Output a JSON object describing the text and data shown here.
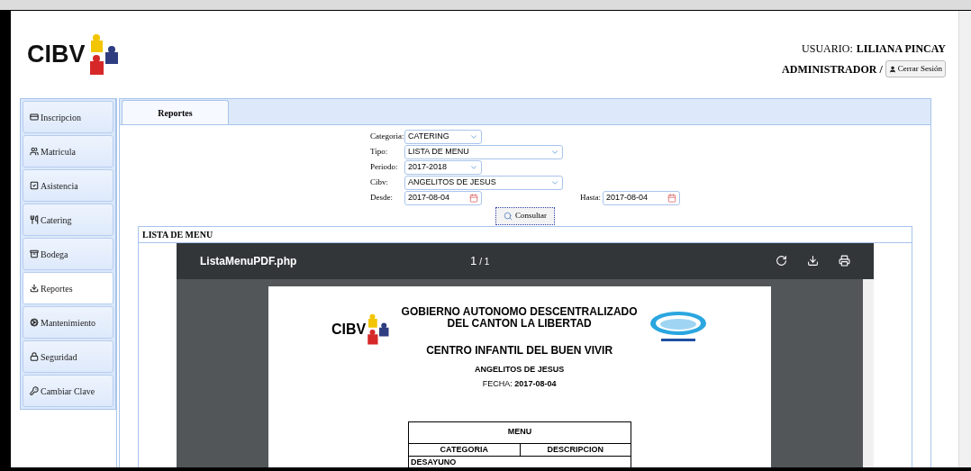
{
  "header": {
    "logo_text": "CIBV",
    "user_label": "USUARIO:",
    "user_name": "LILIANA PINCAY",
    "role": "ADMINISTRADOR /",
    "logout_button": "Cerrar Sesión"
  },
  "sidebar": {
    "items": [
      {
        "label": "Inscripcion",
        "selected": false
      },
      {
        "label": "Matricula",
        "selected": false
      },
      {
        "label": "Asistencia",
        "selected": false
      },
      {
        "label": "Catering",
        "selected": false
      },
      {
        "label": "Bodega",
        "selected": false
      },
      {
        "label": "Reportes",
        "selected": true
      },
      {
        "label": "Mantenimiento",
        "selected": false
      },
      {
        "label": "Seguridad",
        "selected": false
      },
      {
        "label": "Cambiar Clave",
        "selected": false
      }
    ]
  },
  "tabs": [
    {
      "label": "Reportes",
      "selected": true
    }
  ],
  "form": {
    "fields": [
      {
        "label": "Categoria:",
        "value": "CATERING",
        "kind": "select"
      },
      {
        "label": "Tipo:",
        "value": "LISTA DE MENU",
        "kind": "select"
      },
      {
        "label": "Periodo:",
        "value": "2017-2018",
        "kind": "select"
      },
      {
        "label": "Cibv:",
        "value": "ANGELITOS DE JESUS",
        "kind": "select"
      },
      {
        "label": "Desde:",
        "value": "2017-08-04",
        "kind": "date"
      }
    ],
    "end_date": {
      "label": "Hasta:",
      "value": "2017-08-04"
    },
    "submit_button": "Consultar"
  },
  "result_panel": {
    "title": "LISTA DE MENU",
    "pdf_viewer": {
      "filename": "ListaMenuPDF.php",
      "page_current": "1",
      "page_total": "/ 1",
      "document": {
        "logo_text": "CIBV",
        "title_lines": [
          "GOBIERNO AUTONOMO DESCENTRALIZADO",
          "DEL CANTON LA LIBERTAD"
        ],
        "subtitle": "CENTRO INFANTIL DEL BUEN VIVIR",
        "center_name": "ANGELITOS DE JESUS",
        "date_label": "FECHA:",
        "date_value": "2017-08-04",
        "table": {
          "title": "MENU",
          "columns": [
            "CATEGORIA",
            "DESCRIPCION"
          ],
          "rows": [
            "DESAYUNO"
          ]
        }
      }
    }
  }
}
